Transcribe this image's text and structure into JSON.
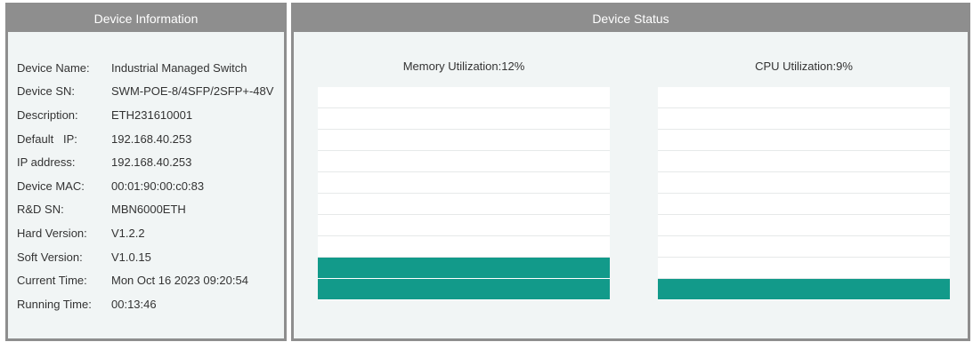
{
  "device_info": {
    "title": "Device Information",
    "rows": [
      {
        "label": "Device Name:",
        "value": "Industrial Managed Switch"
      },
      {
        "label": "Device SN:",
        "value": "SWM-POE-8/4SFP/2SFP+-48V"
      },
      {
        "label": "Description:",
        "value": "ETH231610001"
      },
      {
        "label": "Default   IP:",
        "value": "192.168.40.253"
      },
      {
        "label": "IP address:",
        "value": "192.168.40.253"
      },
      {
        "label": "Device MAC:",
        "value": "00:01:90:00:c0:83"
      },
      {
        "label": "R&D SN:",
        "value": "MBN6000ETH"
      },
      {
        "label": "Hard Version:",
        "value": "V1.2.2"
      },
      {
        "label": "Soft Version:",
        "value": "V1.0.15"
      },
      {
        "label": "Current Time:",
        "value": "Mon Oct 16 2023 09:20:54"
      },
      {
        "label": "Running Time:",
        "value": "00:13:46"
      }
    ]
  },
  "device_status": {
    "title": "Device Status",
    "memory": {
      "label": "Memory Utilization:12%",
      "percent": 12
    },
    "cpu": {
      "label": "CPU Utilization:9%",
      "percent": 9
    },
    "colors": {
      "fill": "#129a8a",
      "panel_bg": "#f1f5f5",
      "header": "#8e8e8e"
    }
  }
}
